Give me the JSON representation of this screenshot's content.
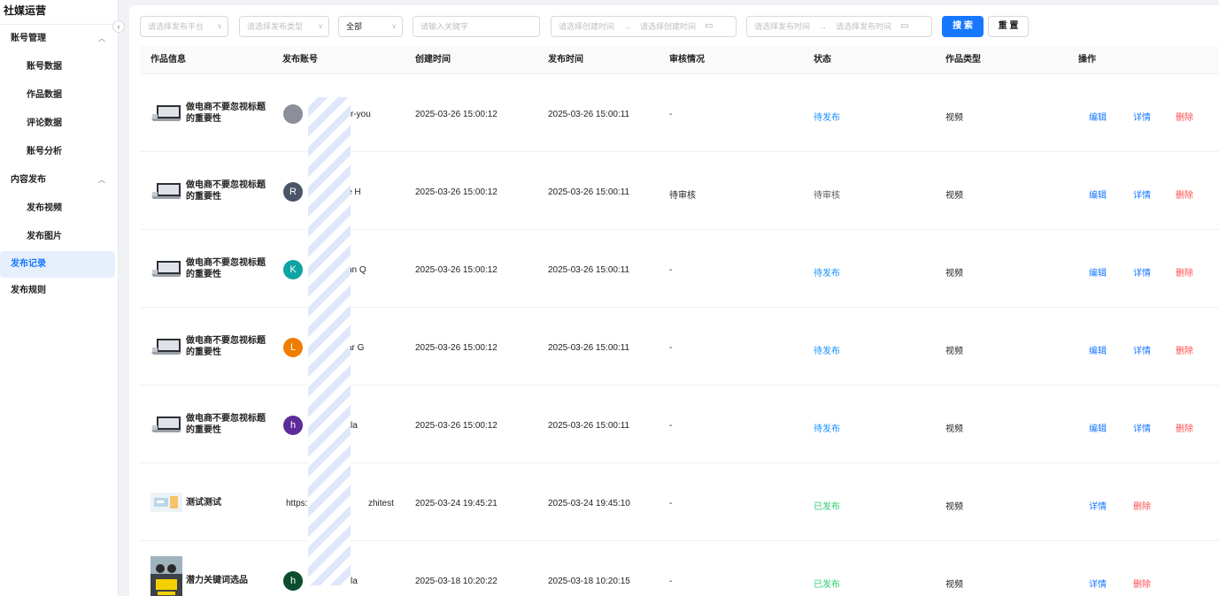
{
  "sidebar": {
    "brand": "社媒运营",
    "groups": [
      {
        "label": "账号管理",
        "items": [
          "账号数据",
          "作品数据",
          "评论数据",
          "账号分析"
        ]
      },
      {
        "label": "内容发布",
        "items": [
          "发布视频",
          "发布图片"
        ]
      }
    ],
    "top_items": [
      "发布记录",
      "发布规则"
    ],
    "active": "发布记录"
  },
  "filters": {
    "platform_placeholder": "请选择发布平台",
    "type_placeholder": "请选择发布类型",
    "status_value": "全部",
    "keyword_placeholder": "请输入关键字",
    "create_start": "请选择创建时间",
    "create_end": "请选择创建时间",
    "publish_start": "请选择发布时间",
    "publish_end": "请选择发布时间",
    "range_sep": "→",
    "search_label": "搜 索",
    "reset_label": "重 置"
  },
  "table": {
    "headers": [
      "作品信息",
      "发布账号",
      "创建时间",
      "发布时间",
      "审核情况",
      "状态",
      "作品类型",
      "操作"
    ],
    "rows": [
      {
        "title": "做电商不要忽视标题的重要性",
        "account": "r-you",
        "avatar_letter": "",
        "avatar_color": "#8a8f99",
        "created": "2025-03-26 15:00:12",
        "published": "2025-03-26 15:00:11",
        "review": "-",
        "status": "待发布",
        "status_kind": "pending",
        "type": "视频",
        "actions": [
          "编辑",
          "详情",
          "删除"
        ]
      },
      {
        "title": "做电商不要忽视标题的重要性",
        "account": "e H",
        "avatar_letter": "R",
        "avatar_color": "#4a5568",
        "created": "2025-03-26 15:00:12",
        "published": "2025-03-26 15:00:11",
        "review": "待审核",
        "status": "待审核",
        "status_kind": "review",
        "type": "视频",
        "actions": [
          "编辑",
          "详情",
          "删除"
        ]
      },
      {
        "title": "做电商不要忽视标题的重要性",
        "account": "nn Q",
        "avatar_letter": "K",
        "avatar_color": "#0fa3a3",
        "created": "2025-03-26 15:00:12",
        "published": "2025-03-26 15:00:11",
        "review": "-",
        "status": "待发布",
        "status_kind": "pending",
        "type": "视频",
        "actions": [
          "编辑",
          "详情",
          "删除"
        ]
      },
      {
        "title": "做电商不要忽视标题的重要性",
        "account": "ar G",
        "avatar_letter": "L",
        "avatar_color": "#f07c00",
        "created": "2025-03-26 15:00:12",
        "published": "2025-03-26 15:00:11",
        "review": "-",
        "status": "待发布",
        "status_kind": "pending",
        "type": "视频",
        "actions": [
          "编辑",
          "详情",
          "删除"
        ]
      },
      {
        "title": "做电商不要忽视标题的重要性",
        "account": "la",
        "avatar_letter": "h",
        "avatar_color": "#5b2c9a",
        "created": "2025-03-26 15:00:12",
        "published": "2025-03-26 15:00:11",
        "review": "-",
        "status": "待发布",
        "status_kind": "pending",
        "type": "视频",
        "actions": [
          "编辑",
          "详情",
          "删除"
        ]
      },
      {
        "title": "测试测试",
        "account": "https:",
        "account_suffix": "zhitest",
        "avatar_letter": "",
        "avatar_color": "",
        "created": "2025-03-24 19:45:21",
        "published": "2025-03-24 19:45:10",
        "review": "-",
        "status": "已发布",
        "status_kind": "done",
        "type": "视频",
        "actions": [
          "详情",
          "删除"
        ]
      },
      {
        "title": "潜力关键词选品",
        "account": "la",
        "avatar_letter": "h",
        "avatar_color": "#0b4d2e",
        "created": "2025-03-18 10:20:22",
        "published": "2025-03-18 10:20:15",
        "review": "-",
        "status": "已发布",
        "status_kind": "done",
        "type": "视频",
        "actions": [
          "详情",
          "删除"
        ]
      }
    ]
  },
  "colors": {
    "primary": "#1677ff",
    "danger": "#ff4d4f",
    "success": "#2ecc71"
  }
}
